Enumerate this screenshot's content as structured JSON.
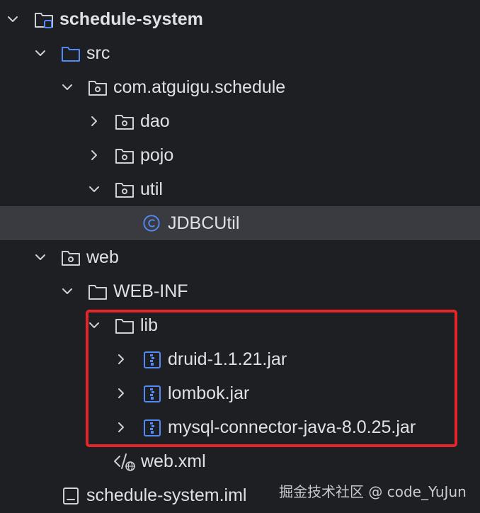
{
  "project_tree": {
    "root": {
      "label": "schedule-system"
    },
    "src": {
      "label": "src"
    },
    "package": {
      "label": "com.atguigu.schedule"
    },
    "dao": {
      "label": "dao"
    },
    "pojo": {
      "label": "pojo"
    },
    "util": {
      "label": "util"
    },
    "jdbcutil": {
      "label": "JDBCUtil"
    },
    "web": {
      "label": "web"
    },
    "web_inf": {
      "label": "WEB-INF"
    },
    "lib": {
      "label": "lib"
    },
    "jars": [
      {
        "label": "druid-1.1.21.jar"
      },
      {
        "label": "lombok.jar"
      },
      {
        "label": "mysql-connector-java-8.0.25.jar"
      }
    ],
    "web_xml": {
      "label": "web.xml"
    },
    "iml": {
      "label": "schedule-system.iml"
    }
  },
  "watermark": {
    "text": "掘金技术社区 @ code_YuJun"
  },
  "colors": {
    "background": "#1e1f22",
    "selected_row": "#393b40",
    "text": "#dfe1e5",
    "folder_icon": "#ced0d6",
    "source_folder_icon": "#548af7",
    "class_icon": "#548af7",
    "highlight_border": "#e3262a"
  }
}
